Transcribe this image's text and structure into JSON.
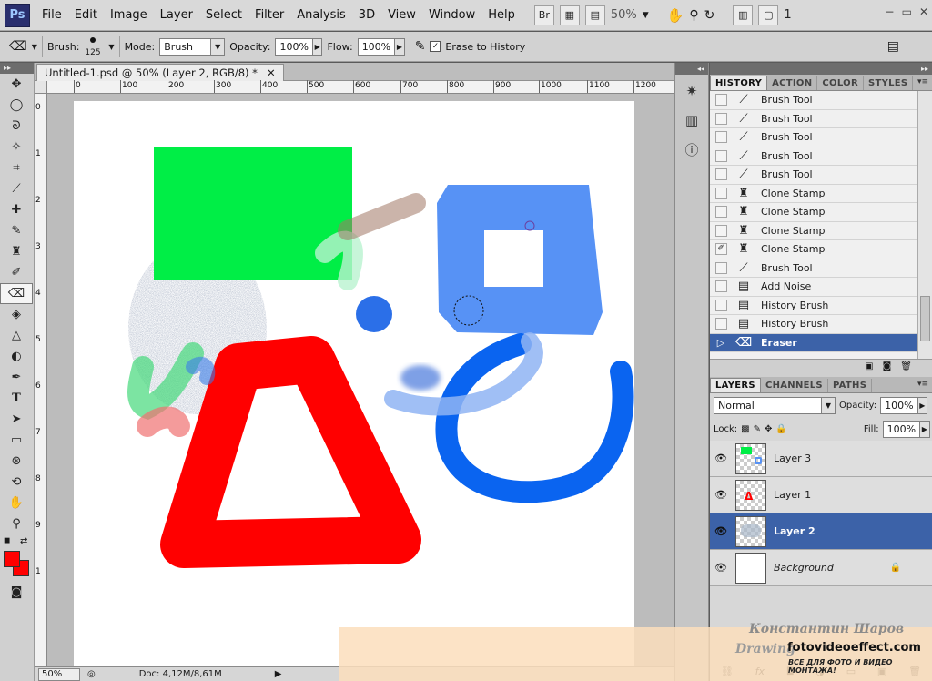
{
  "app": {
    "logo": "Ps"
  },
  "menu": [
    "File",
    "Edit",
    "Image",
    "Layer",
    "Select",
    "Filter",
    "Analysis",
    "3D",
    "View",
    "Window",
    "Help"
  ],
  "menubar_right": {
    "bridge": "Br",
    "zoom": "50%",
    "screen_mode": "1"
  },
  "options": {
    "brush_label": "Brush:",
    "brush_size": "125",
    "mode_label": "Mode:",
    "mode_value": "Brush",
    "opacity_label": "Opacity:",
    "opacity_value": "100%",
    "flow_label": "Flow:",
    "flow_value": "100%",
    "erase_history_label": "Erase to History",
    "erase_history_checked": true
  },
  "document": {
    "tab_title": "Untitled-1.psd @ 50% (Layer 2, RGB/8) *",
    "ruler_h": [
      "0",
      "100",
      "200",
      "300",
      "400",
      "500",
      "600",
      "700",
      "800",
      "900",
      "1000",
      "1100",
      "1200"
    ],
    "ruler_v": [
      "0",
      "1",
      "2",
      "3",
      "4",
      "5",
      "6",
      "7",
      "8",
      "9",
      "1"
    ],
    "status_zoom": "50%",
    "status_doc": "Doc: 4,12M/8,61M"
  },
  "history_panel": {
    "tabs": [
      "HISTORY",
      "ACTION",
      "COLOR",
      "STYLES"
    ],
    "items": [
      {
        "label": "Brush Tool",
        "icon": "brush-icon"
      },
      {
        "label": "Brush Tool",
        "icon": "brush-icon"
      },
      {
        "label": "Brush Tool",
        "icon": "brush-icon"
      },
      {
        "label": "Brush Tool",
        "icon": "brush-icon"
      },
      {
        "label": "Brush Tool",
        "icon": "brush-icon"
      },
      {
        "label": "Clone Stamp",
        "icon": "stamp-icon"
      },
      {
        "label": "Clone Stamp",
        "icon": "stamp-icon"
      },
      {
        "label": "Clone Stamp",
        "icon": "stamp-icon"
      },
      {
        "label": "Clone Stamp",
        "icon": "stamp-icon"
      },
      {
        "label": "Brush Tool",
        "icon": "brush-icon"
      },
      {
        "label": "Add Noise",
        "icon": "document-icon"
      },
      {
        "label": "History Brush",
        "icon": "document-icon"
      },
      {
        "label": "History Brush",
        "icon": "document-icon"
      },
      {
        "label": "Eraser",
        "icon": "eraser-icon"
      }
    ]
  },
  "layers_panel": {
    "tabs": [
      "LAYERS",
      "CHANNELS",
      "PATHS"
    ],
    "blend_mode": "Normal",
    "opacity_label": "Opacity:",
    "opacity_value": "100%",
    "lock_label": "Lock:",
    "fill_label": "Fill:",
    "fill_value": "100%",
    "layers": [
      {
        "name": "Layer 3"
      },
      {
        "name": "Layer 1"
      },
      {
        "name": "Layer 2"
      },
      {
        "name": "Background"
      }
    ]
  },
  "watermark": {
    "author": "Константин Шаров",
    "tagline": "Drawing",
    "site": "fotovideoeffect.com",
    "small": "ВСЕ ДЛЯ ФОТО И ВИДЕО МОНТАЖА!"
  },
  "colors": {
    "accent": "#3c62a8",
    "foreground": "#ff0000",
    "background_swatch": "#ff0000"
  }
}
